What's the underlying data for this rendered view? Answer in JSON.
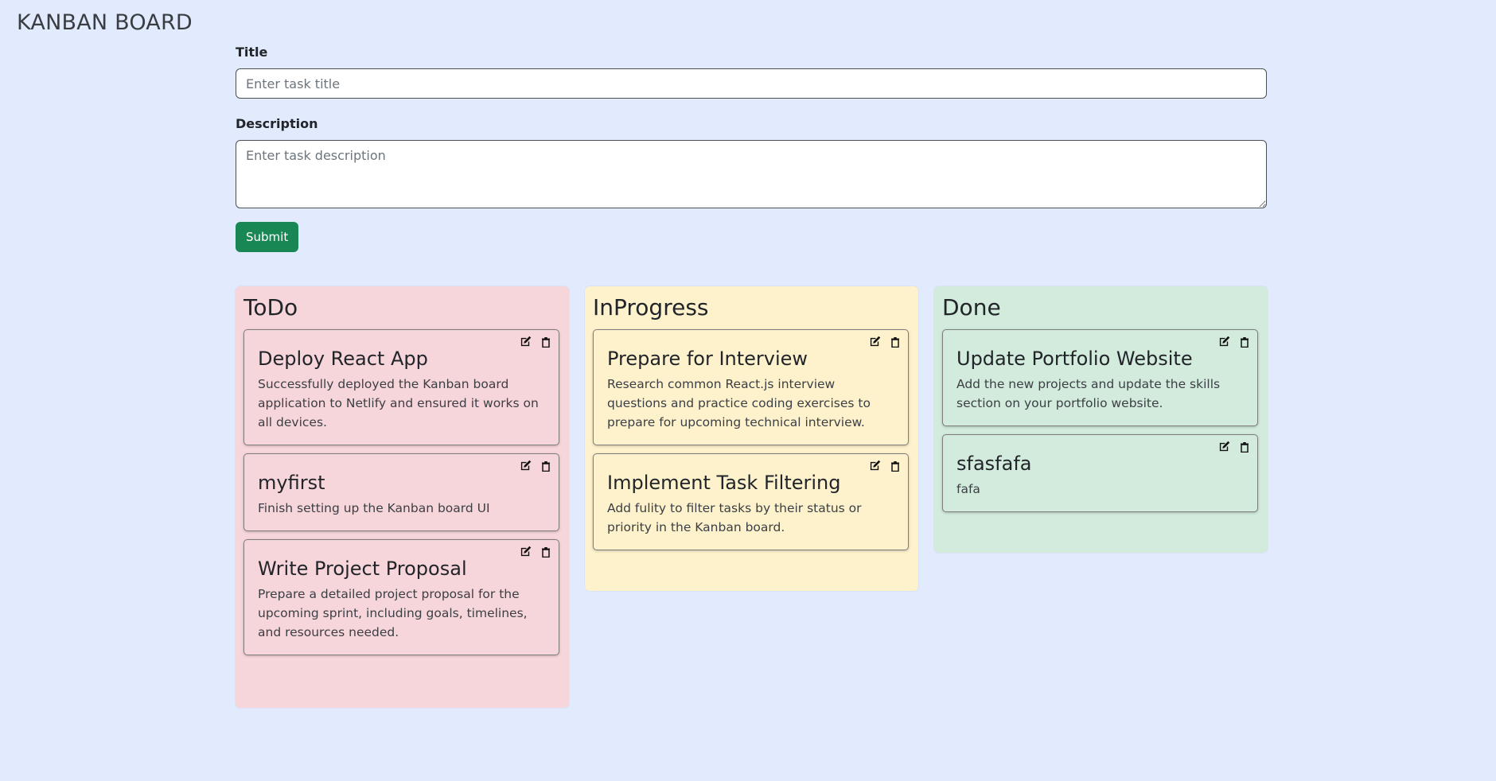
{
  "app": {
    "title": "KANBAN BOARD"
  },
  "form": {
    "title_label": "Title",
    "title_placeholder": "Enter task title",
    "title_value": "",
    "description_label": "Description",
    "description_placeholder": "Enter task description",
    "description_value": "",
    "submit_label": "Submit"
  },
  "colors": {
    "background": "#e1ebfd",
    "todo": "#f7d6db",
    "inprogress": "#fef2cd",
    "done": "#d2ebdd",
    "submit": "#198754"
  },
  "columns": [
    {
      "title": "ToDo",
      "cards": [
        {
          "title": "Deploy React App",
          "description": "Successfully deployed the Kanban board application to Netlify and ensured it works on all devices.",
          "edit_icon": "edit-icon",
          "delete_icon": "trash-icon"
        },
        {
          "title": "myfirst",
          "description": "Finish setting up the Kanban board UI",
          "edit_icon": "edit-icon",
          "delete_icon": "trash-icon"
        },
        {
          "title": "Write Project Proposal",
          "description": "Prepare a detailed project proposal for the upcoming sprint, including goals, timelines, and resources needed.",
          "edit_icon": "edit-icon",
          "delete_icon": "trash-icon"
        }
      ]
    },
    {
      "title": "InProgress",
      "cards": [
        {
          "title": "Prepare for Interview",
          "description": "Research common React.js interview questions and practice coding exercises to prepare for upcoming technical interview.",
          "edit_icon": "edit-icon",
          "delete_icon": "trash-icon"
        },
        {
          "title": "Implement Task Filtering",
          "description": "Add fulity to filter tasks by their status or priority in the Kanban board.",
          "edit_icon": "edit-icon",
          "delete_icon": "trash-icon"
        }
      ]
    },
    {
      "title": "Done",
      "cards": [
        {
          "title": "Update Portfolio Website",
          "description": "Add the new projects and update the skills section on your portfolio website.",
          "edit_icon": "edit-icon",
          "delete_icon": "trash-icon"
        },
        {
          "title": "sfasfafa",
          "description": "fafa",
          "edit_icon": "edit-icon",
          "delete_icon": "trash-icon"
        }
      ]
    }
  ]
}
